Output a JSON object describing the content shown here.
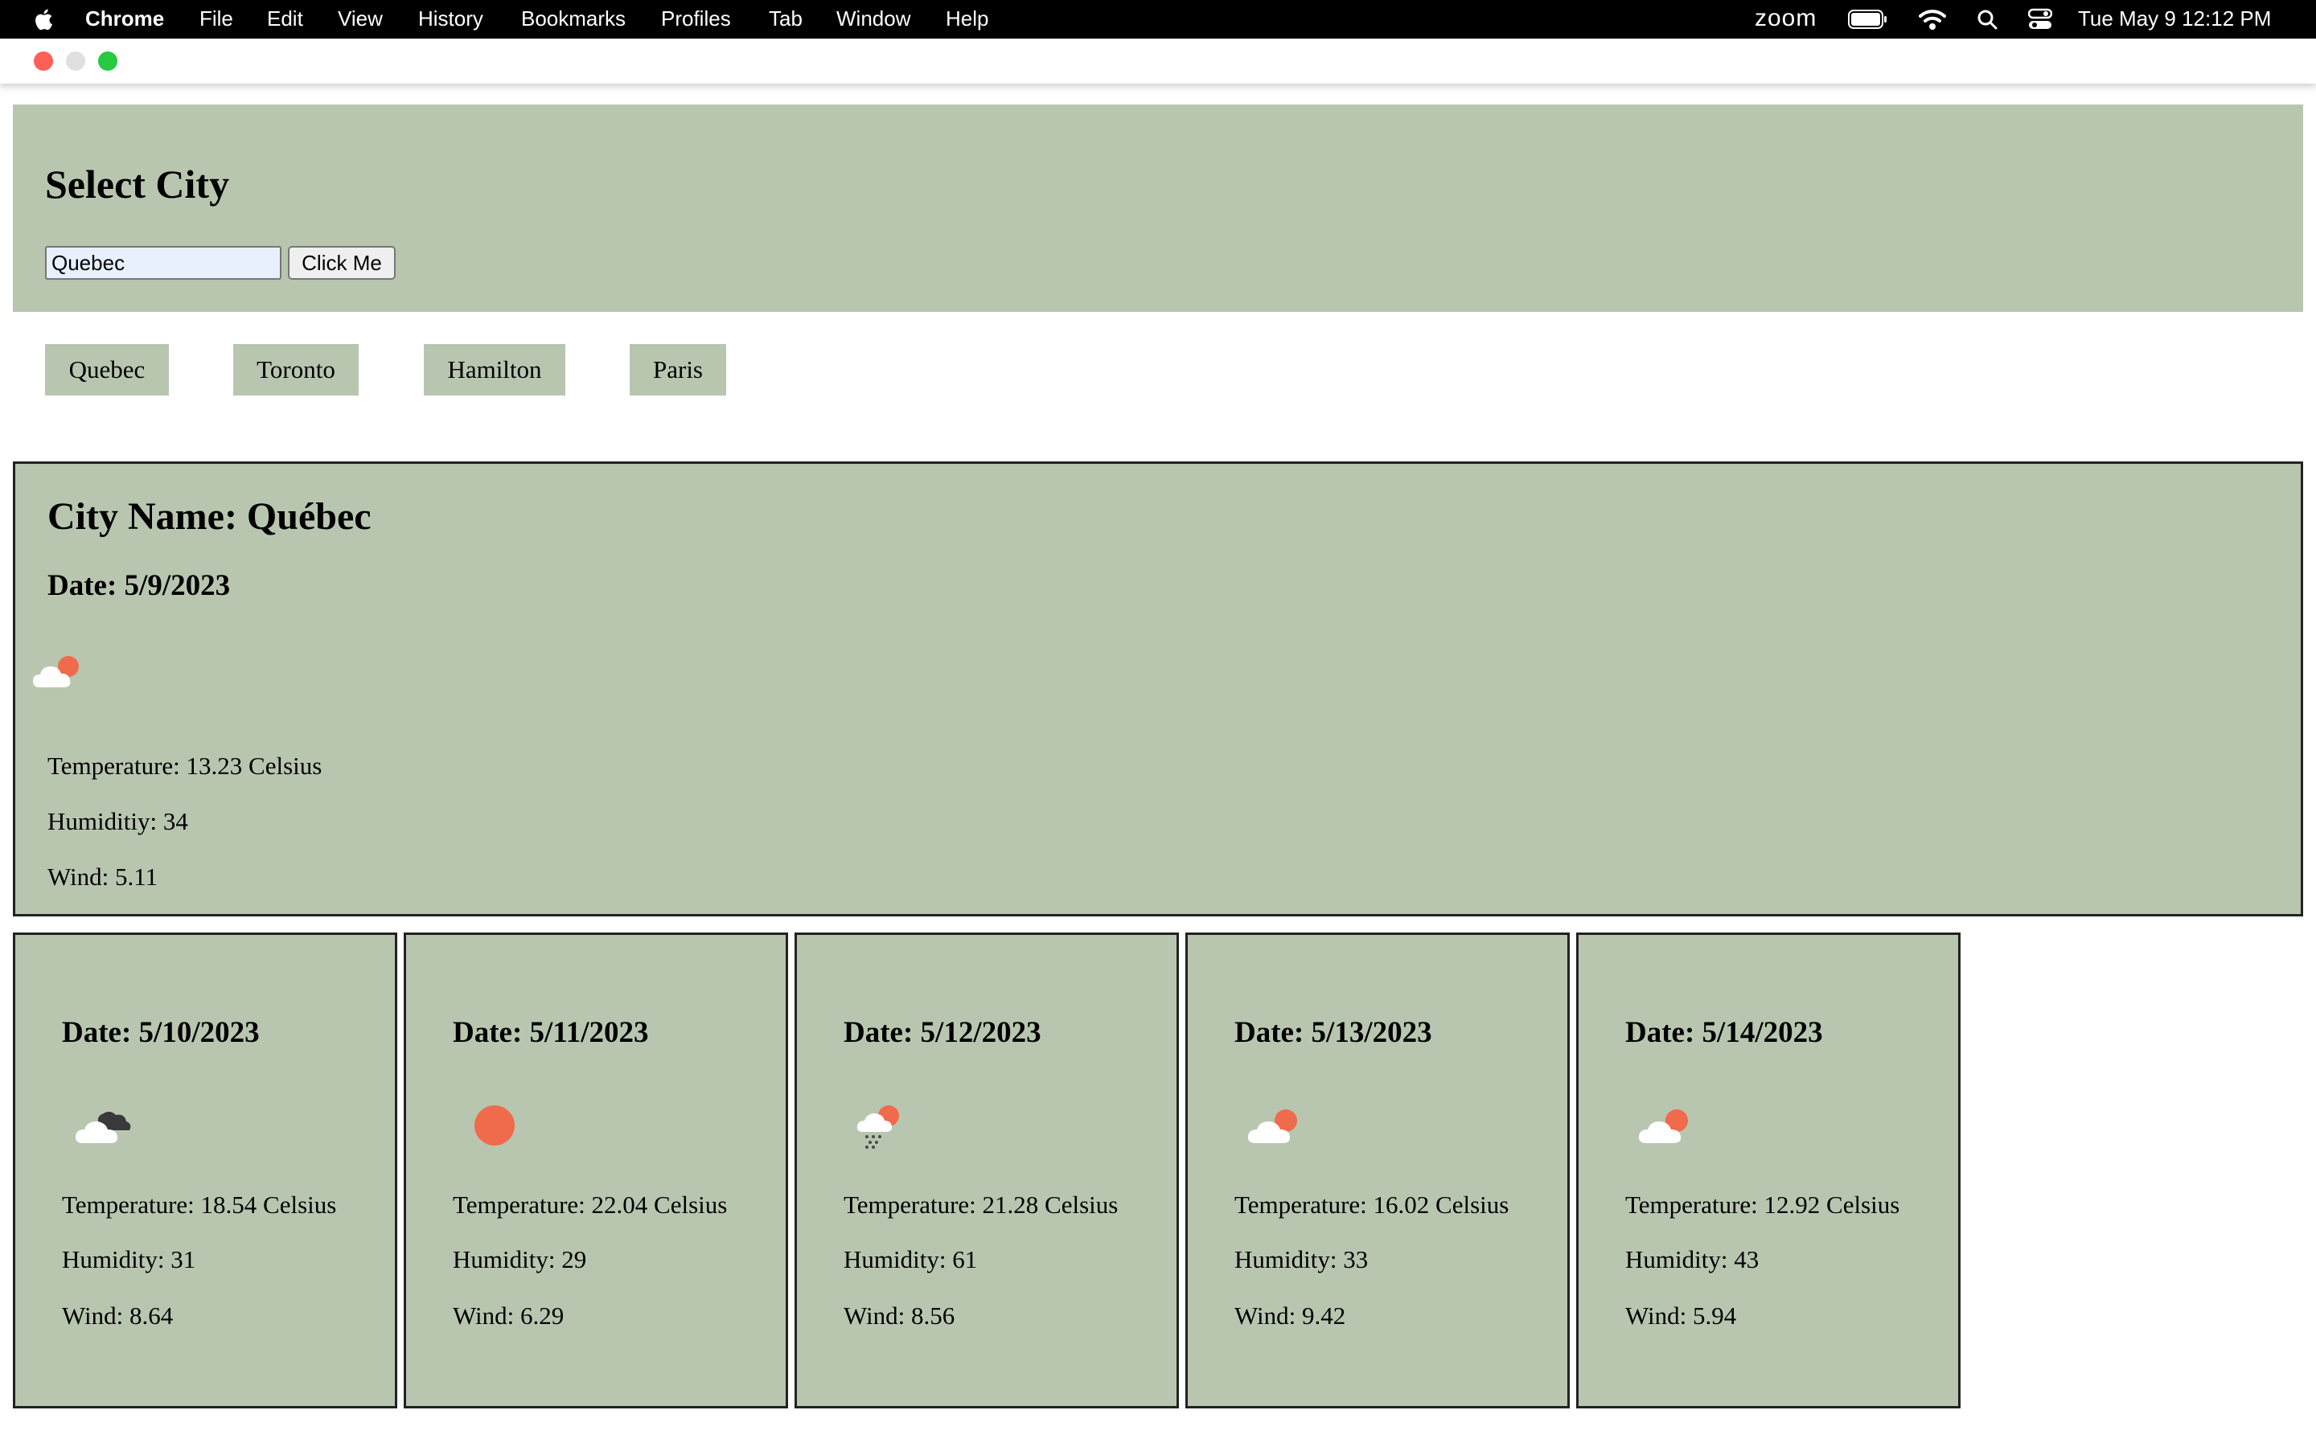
{
  "menubar": {
    "app_name": "Chrome",
    "items": [
      "File",
      "Edit",
      "View",
      "History",
      "Bookmarks",
      "Profiles",
      "Tab",
      "Window",
      "Help"
    ],
    "status_app": "zoom",
    "datetime": "Tue May 9  12:12 PM"
  },
  "header": {
    "title": "Select City",
    "input_value": "Quebec",
    "button_label": "Click Me"
  },
  "city_buttons": [
    "Quebec",
    "Toronto",
    "Hamilton",
    "Paris"
  ],
  "current": {
    "city_name": "City Name: Québec",
    "date": "Date: 5/9/2023",
    "icon": "cloud-sun-icon",
    "temperature": "Temperature: 13.23 Celsius",
    "humidity": "Humiditiy: 34",
    "wind": "Wind: 5.11"
  },
  "forecast": [
    {
      "date": "Date: 5/10/2023",
      "icon": "dark-clouds-icon",
      "temperature": "Temperature: 18.54 Celsius",
      "humidity": "Humidity: 31",
      "wind": "Wind: 8.64"
    },
    {
      "date": "Date: 5/11/2023",
      "icon": "sun-icon",
      "temperature": "Temperature: 22.04 Celsius",
      "humidity": "Humidity: 29",
      "wind": "Wind: 6.29"
    },
    {
      "date": "Date: 5/12/2023",
      "icon": "rain-cloud-sun-icon",
      "temperature": "Temperature: 21.28 Celsius",
      "humidity": "Humidity: 61",
      "wind": "Wind: 8.56"
    },
    {
      "date": "Date: 5/13/2023",
      "icon": "cloud-sun-icon",
      "temperature": "Temperature: 16.02 Celsius",
      "humidity": "Humidity: 33",
      "wind": "Wind: 9.42"
    },
    {
      "date": "Date: 5/14/2023",
      "icon": "cloud-sun-icon",
      "temperature": "Temperature: 12.92 Celsius",
      "humidity": "Humidity: 43",
      "wind": "Wind: 5.94"
    }
  ],
  "colors": {
    "panel_bg": "#b8c6b0",
    "sun": "#f06a4c",
    "cloud": "#ffffff",
    "dark_cloud": "#3a3a3a"
  }
}
